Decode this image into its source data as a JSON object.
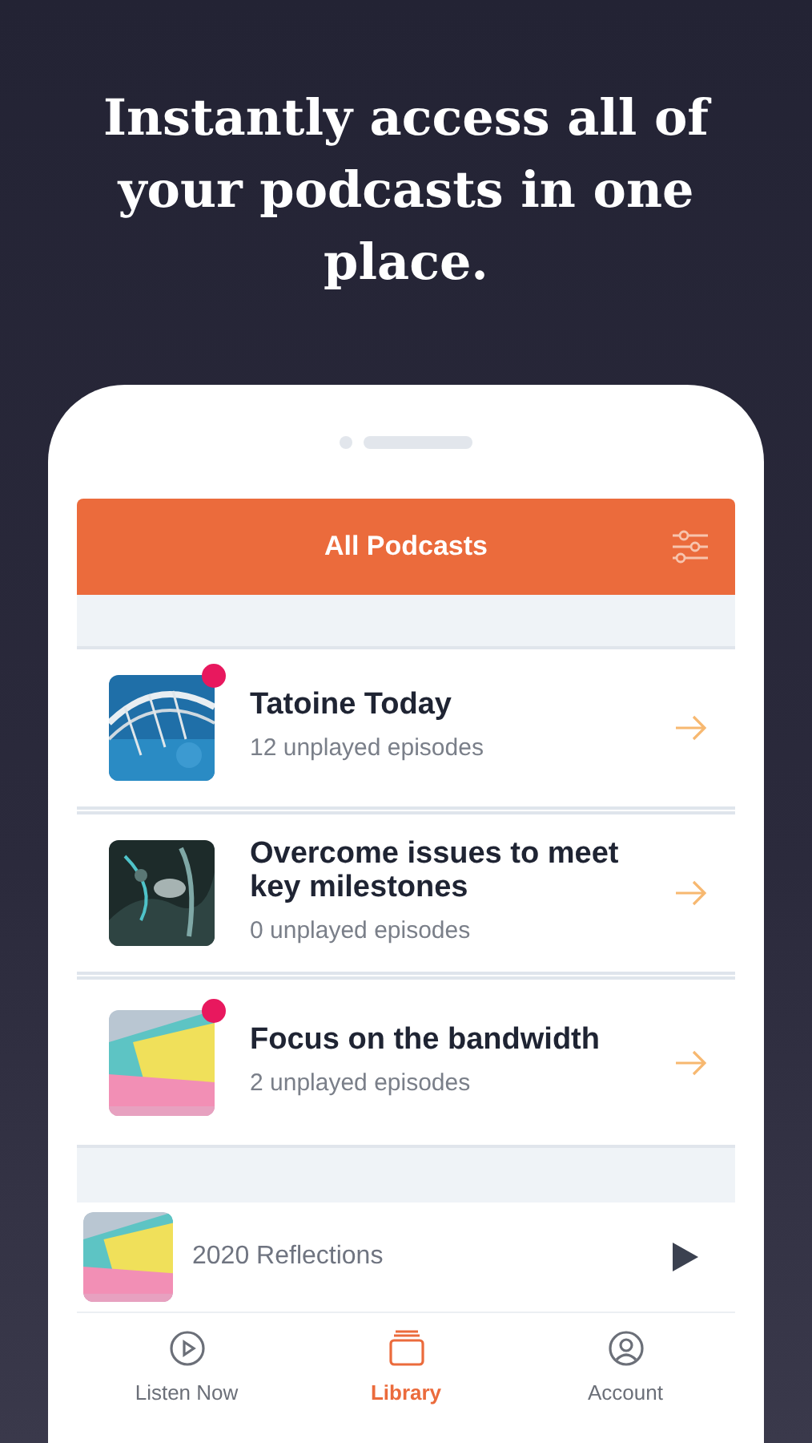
{
  "headline": "Instantly access all of your podcasts in one place.",
  "header": {
    "title": "All Podcasts"
  },
  "podcasts": [
    {
      "title": "Tatoine Today",
      "subtitle": "12 unplayed episodes",
      "unread": true
    },
    {
      "title": "Overcome issues to meet key milestones",
      "subtitle": "0 unplayed episodes",
      "unread": false
    },
    {
      "title": "Focus on the bandwidth",
      "subtitle": "2 unplayed episodes",
      "unread": true
    }
  ],
  "now_playing": {
    "title": "2020 Reflections"
  },
  "tabs": [
    {
      "label": "Listen Now",
      "kind": "listen",
      "selected": false
    },
    {
      "label": "Library",
      "kind": "library",
      "selected": true
    },
    {
      "label": "Account",
      "kind": "account",
      "selected": false
    }
  ]
}
